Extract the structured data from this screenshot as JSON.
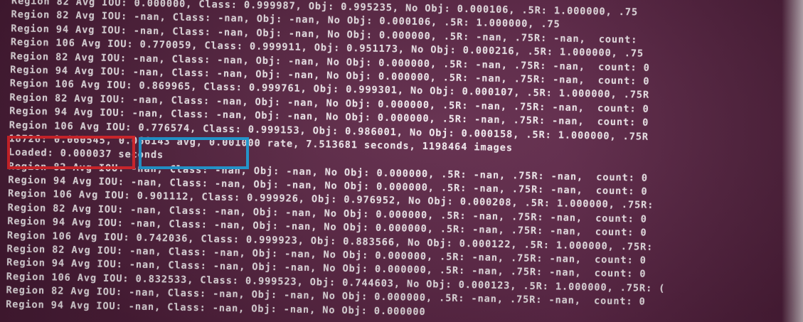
{
  "terminal": {
    "background": "#5a2442",
    "text_color": "#f2e9ee",
    "lines": [
      "Region 82 Avg IOU: 0.000000, Class: 0.999987, Obj: 0.995235, No Obj: 0.000106, .5R: 1.000000, .75",
      "Region 82 Avg IOU: -nan, Class: -nan, Obj: -nan, No Obj: 0.000106, .5R: 1.000000, .75",
      "Region 94 Avg IOU: -nan, Class: -nan, Obj: -nan, No Obj: 0.000000, .5R: -nan, .75R: -nan,  count:",
      "Region 106 Avg IOU: 0.770059, Class: 0.999911, Obj: 0.951173, No Obj: 0.000216, .5R: 1.000000, .75",
      "Region 82 Avg IOU: -nan, Class: -nan, Obj: -nan, No Obj: 0.000000, .5R: -nan, .75R: -nan,  count: 0",
      "Region 94 Avg IOU: -nan, Class: -nan, Obj: -nan, No Obj: 0.000000, .5R: -nan, .75R: -nan,  count: 0",
      "Region 106 Avg IOU: 0.869965, Class: 0.999761, Obj: 0.999301, No Obj: 0.000107, .5R: 1.000000, .75R",
      "Region 82 Avg IOU: -nan, Class: -nan, Obj: -nan, No Obj: 0.000000, .5R: -nan, .75R: -nan,  count: 0",
      "Region 94 Avg IOU: -nan, Class: -nan, Obj: -nan, No Obj: 0.000000, .5R: -nan, .75R: -nan,  count: 0",
      "Region 106 Avg IOU: 0.776574, Class: 0.999153, Obj: 0.986001, No Obj: 0.000158, .5R: 1.000000, .75R",
      "18726: 0.060545, 0.066143 avg, 0.001000 rate, 7.513681 seconds, 1198464 images",
      "Loaded: 0.000037 seconds",
      "Region 82 Avg IOU: -nan, Class: -nan, Obj: -nan, No Obj: 0.000000, .5R: -nan, .75R: -nan,  count: 0",
      "Region 94 Avg IOU: -nan, Class: -nan, Obj: -nan, No Obj: 0.000000, .5R: -nan, .75R: -nan,  count: 0",
      "Region 106 Avg IOU: 0.901112, Class: 0.999926, Obj: 0.976952, No Obj: 0.000208, .5R: 1.000000, .75R:",
      "Region 82 Avg IOU: -nan, Class: -nan, Obj: -nan, No Obj: 0.000000, .5R: -nan, .75R: -nan,  count: 0",
      "Region 94 Avg IOU: -nan, Class: -nan, Obj: -nan, No Obj: 0.000000, .5R: -nan, .75R: -nan,  count: 0",
      "Region 106 Avg IOU: 0.742036, Class: 0.999923, Obj: 0.883566, No Obj: 0.000122, .5R: 1.000000, .75R:",
      "Region 82 Avg IOU: -nan, Class: -nan, Obj: -nan, No Obj: 0.000000, .5R: -nan, .75R: -nan,  count: 0",
      "Region 94 Avg IOU: -nan, Class: -nan, Obj: -nan, No Obj: 0.000000, .5R: -nan, .75R: -nan,  count: 0",
      "Region 106 Avg IOU: 0.832533, Class: 0.999523, Obj: 0.744603, No Obj: 0.000123, .5R: 1.000000, .75R: (",
      "Region 82 Avg IOU: -nan, Class: -nan, Obj: -nan, No Obj: 0.000000, .5R: -nan, .75R: -nan,  count: 0",
      "Region 94 Avg IOU: -nan, Class: -nan, Obj: -nan, No Obj: 0.000000"
    ]
  },
  "annotations": {
    "red_color": "#e0242b",
    "blue_color": "#1e9bd7"
  }
}
